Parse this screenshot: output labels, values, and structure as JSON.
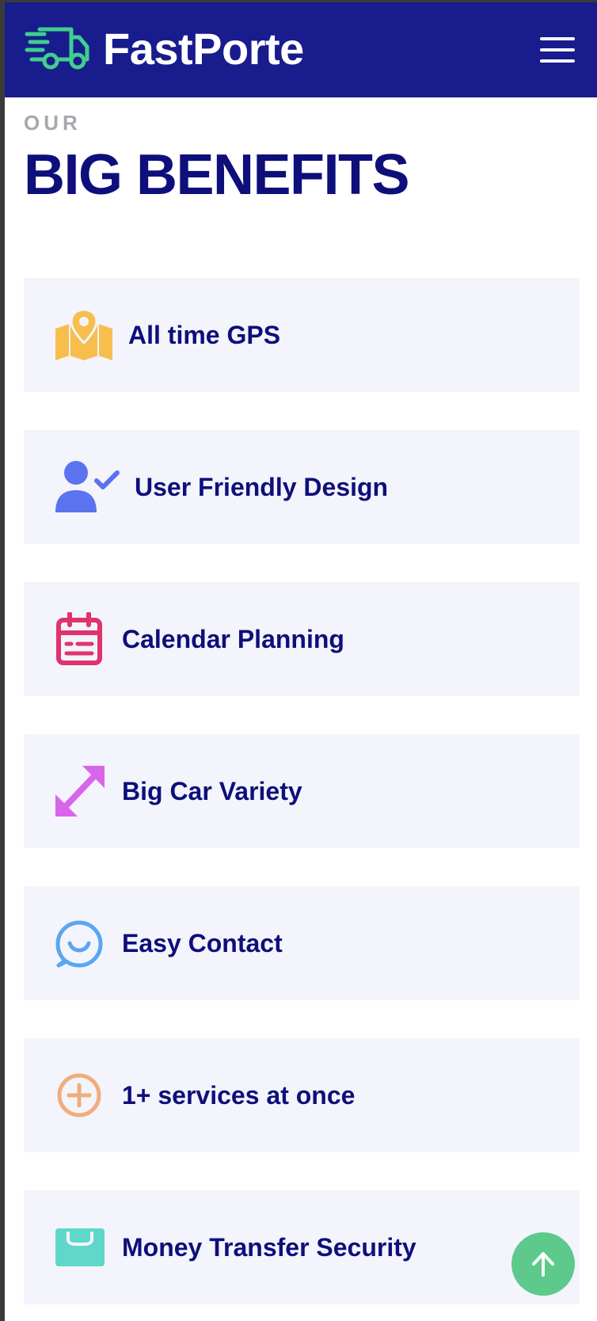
{
  "header": {
    "brand": "FastPorte",
    "logo_icon": "delivery-truck-icon",
    "menu_icon": "hamburger-menu-icon"
  },
  "section": {
    "eyebrow": "OUR",
    "heading": "BIG BENEFITS"
  },
  "benefits": [
    {
      "label": "All time GPS",
      "icon": "map-pin-icon",
      "color": "#f7be4d"
    },
    {
      "label": "User Friendly Design",
      "icon": "user-check-icon",
      "color": "#5b73ee"
    },
    {
      "label": "Calendar Planning",
      "icon": "calendar-icon",
      "color": "#e0336e"
    },
    {
      "label": "Big Car Variety",
      "icon": "expand-arrows-icon",
      "color": "#d965ea"
    },
    {
      "label": "Easy Contact",
      "icon": "chat-bubble-icon",
      "color": "#5aa6f2"
    },
    {
      "label": "1+ services at once",
      "icon": "plus-circle-icon",
      "color": "#f0ad7c"
    },
    {
      "label": "Money Transfer Security",
      "icon": "wallet-icon",
      "color": "#5fd8c9"
    }
  ],
  "scroll_top": {
    "icon": "arrow-up-icon",
    "color": "#5dc98a"
  },
  "colors": {
    "header_bg": "#191c8c",
    "heading": "#0e0f7a",
    "card_bg": "#f3f4fc"
  }
}
